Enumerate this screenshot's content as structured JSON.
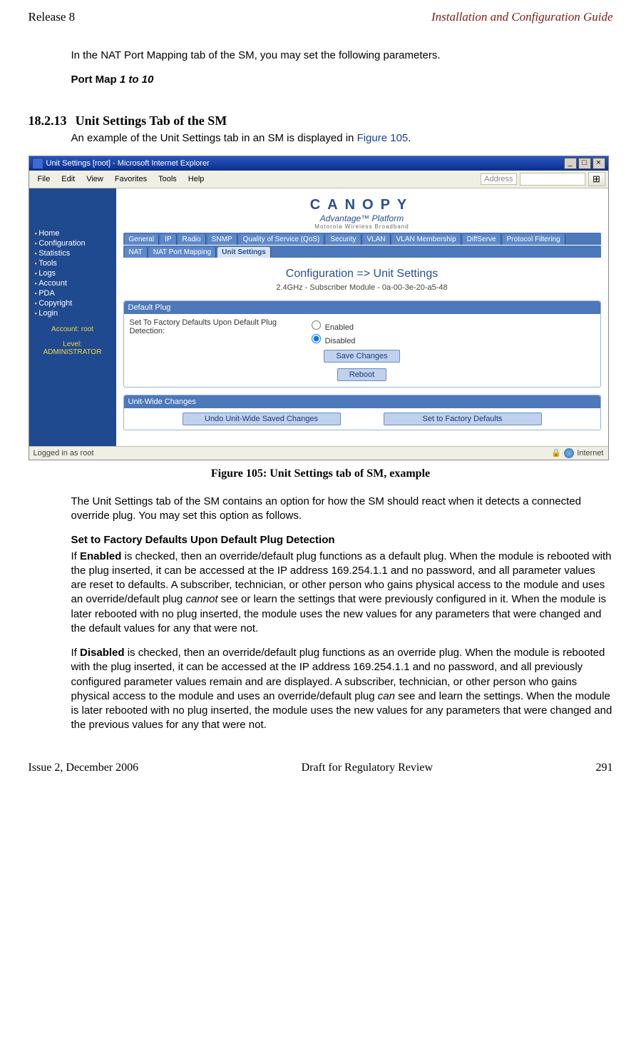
{
  "header": {
    "left": "Release 8",
    "right": "Installation and Configuration Guide"
  },
  "intro": {
    "p1": "In the NAT Port Mapping tab of the SM, you may set the following parameters.",
    "portmap_label": "Port Map ",
    "portmap_range": "1 to 10"
  },
  "section": {
    "num": "18.2.13",
    "title": "Unit Settings Tab of the SM",
    "lead_a": "An example of the Unit Settings tab in an SM is displayed in ",
    "lead_link": "Figure 105",
    "lead_b": "."
  },
  "caption": "Figure 105: Unit Settings tab of SM, example",
  "after": {
    "p1": "The Unit Settings tab of the SM contains an option for how the SM should react when it detects a connected override plug. You may set this option as follows.",
    "sub": "Set to Factory Defaults Upon Default Plug Detection",
    "p2a": "If ",
    "p2_enabled": "Enabled",
    "p2b": " is checked, then an override/default plug functions as a default plug. When the module is rebooted with the plug inserted, it can be accessed at the IP address 169.254.1.1 and no password, and all parameter values are reset to defaults. A subscriber, technician, or other person who gains physical access to the module and uses an override/default plug ",
    "p2_cannot": "cannot",
    "p2c": " see or learn the settings that were previously configured in it. When the module is later rebooted with no plug inserted, the module uses the new values for any parameters that were changed and the default values for any that were not.",
    "p3a": "If ",
    "p3_disabled": "Disabled",
    "p3b": " is checked, then an override/default plug functions as an override plug. When the module is rebooted with the plug inserted, it can be accessed at the IP address 169.254.1.1 and no password, and all previously configured parameter values remain and are displayed. A subscriber, technician, or other person who gains physical access to the module and uses an override/default plug ",
    "p3_can": "can",
    "p3c": " see and learn the settings. When the module is later rebooted with no plug inserted, the module uses the new values for any parameters that were changed and the previous values for any that were not."
  },
  "footer": {
    "left": "Issue 2, December 2006",
    "center": "Draft for Regulatory Review",
    "right": "291"
  },
  "shot": {
    "title": "Unit Settings [root] - Microsoft Internet Explorer",
    "menus": {
      "file": "File",
      "edit": "Edit",
      "view": "View",
      "fav": "Favorites",
      "tools": "Tools",
      "help": "Help"
    },
    "address_label": "Address",
    "sidebar": {
      "items": [
        "Home",
        "Configuration",
        "Statistics",
        "Tools",
        "Logs",
        "Account",
        "PDA",
        "Copyright",
        "Login"
      ],
      "acct1": "Account: root",
      "acct2": "Level: ADMINISTRATOR"
    },
    "logo": {
      "brand": "CANOPY",
      "sub": "Advantage™ Platform",
      "sub2": "Motorola Wireless Broadband"
    },
    "tabs1": [
      "General",
      "IP",
      "Radio",
      "SNMP",
      "Quality of Service (QoS)",
      "Security",
      "VLAN",
      "VLAN Membership",
      "DiffServe",
      "Protocol Filtering"
    ],
    "tabs2": [
      "NAT",
      "NAT Port Mapping",
      "Unit Settings"
    ],
    "page_title": "Configuration => Unit Settings",
    "page_sub": "2.4GHz - Subscriber Module - 0a-00-3e-20-a5-48",
    "panel1": {
      "hdr": "Default Plug",
      "label": "Set To Factory Defaults Upon Default Plug Detection:",
      "opt_enabled": "Enabled",
      "opt_disabled": "Disabled",
      "btn_save": "Save Changes",
      "btn_reboot": "Reboot"
    },
    "panel2": {
      "hdr": "Unit-Wide Changes",
      "btn_undo": "Undo Unit-Wide Saved Changes",
      "btn_factory": "Set to Factory Defaults"
    },
    "status": {
      "left": "Logged in as root",
      "right": "Internet"
    }
  }
}
